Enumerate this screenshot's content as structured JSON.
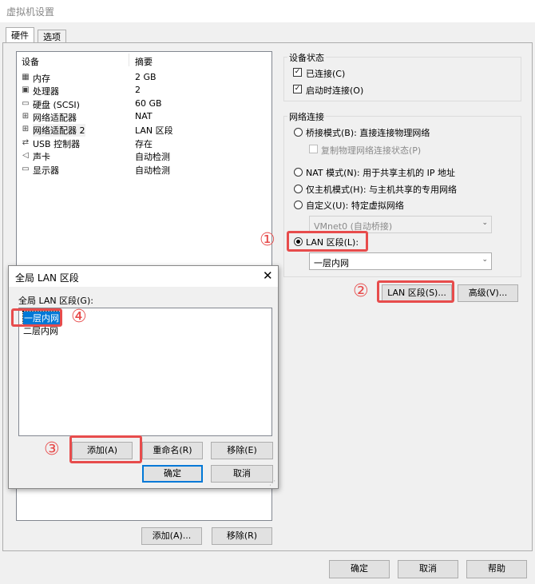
{
  "window": {
    "title": "虚拟机设置"
  },
  "tabs": [
    {
      "label": "硬件"
    },
    {
      "label": "选项"
    }
  ],
  "device_list": {
    "header": {
      "device": "设备",
      "summary": "摘要"
    },
    "rows": [
      {
        "icon": "memory-icon",
        "name": "内存",
        "summary": "2 GB"
      },
      {
        "icon": "processor-icon",
        "name": "处理器",
        "summary": "2"
      },
      {
        "icon": "hard-disk-icon",
        "name": "硬盘 (SCSI)",
        "summary": "60 GB"
      },
      {
        "icon": "network-adapter-icon",
        "name": "网络适配器",
        "summary": "NAT"
      },
      {
        "icon": "network-adapter-icon",
        "name": "网络适配器 2",
        "summary": "LAN 区段"
      },
      {
        "icon": "usb-icon",
        "name": "USB 控制器",
        "summary": "存在"
      },
      {
        "icon": "sound-card-icon",
        "name": "声卡",
        "summary": "自动检测"
      },
      {
        "icon": "display-icon",
        "name": "显示器",
        "summary": "自动检测"
      }
    ],
    "add_button": "添加(A)...",
    "remove_button": "移除(R)"
  },
  "device_status": {
    "title": "设备状态",
    "connected": {
      "label": "已连接(C)",
      "checked": true
    },
    "connect_on_power": {
      "label": "启动时连接(O)",
      "checked": true
    }
  },
  "network": {
    "title": "网络连接",
    "bridged": "桥接模式(B): 直接连接物理网络",
    "replicate": "复制物理网络连接状态(P)",
    "nat": "NAT 模式(N): 用于共享主机的 IP 地址",
    "host_only": "仅主机模式(H): 与主机共享的专用网络",
    "custom": "自定义(U): 特定虚拟网络",
    "vmnet_value": "VMnet0 (自动桥接)",
    "lan_segment": "LAN 区段(L):",
    "lan_value": "一层内网",
    "lan_segments_button": "LAN 区段(S)...",
    "advanced_button": "高级(V)..."
  },
  "footer": {
    "ok": "确定",
    "cancel": "取消",
    "help": "帮助"
  },
  "dialog": {
    "title": "全局 LAN 区段",
    "list_label": "全局 LAN 区段(G):",
    "items": [
      "一层内网",
      "二层内网"
    ],
    "add": "添加(A)",
    "rename": "重命名(R)",
    "remove": "移除(E)",
    "ok": "确定",
    "cancel": "取消"
  },
  "annotations": [
    "①",
    "②",
    "③",
    "④"
  ],
  "colors": {
    "highlight": "#e74c4c",
    "selection": "#0078d7"
  }
}
